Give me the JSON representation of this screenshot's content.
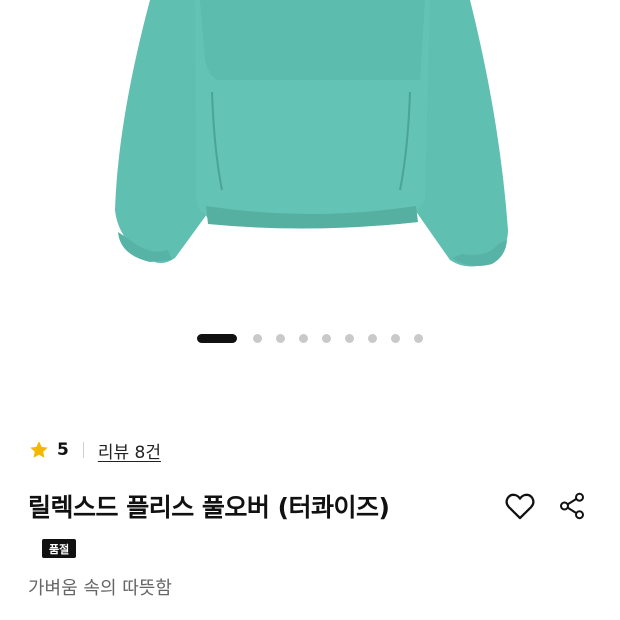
{
  "product": {
    "image_alt": "fleece pullover turquoise",
    "garment_color": "#5fbfb0",
    "garment_shadow": "#4aa595",
    "title": "릴렉스드 플리스 풀오버 (터콰이즈)",
    "badge": "품절",
    "subtitle": "가벼움 속의 따뜻함"
  },
  "carousel": {
    "total_slides": 9,
    "active_index": 0
  },
  "rating": {
    "score": "5",
    "review_label": "리뷰 8건",
    "star_color": "#f5b800"
  },
  "actions": {
    "wishlist_icon": "heart-outline-icon",
    "share_icon": "share-icon"
  }
}
